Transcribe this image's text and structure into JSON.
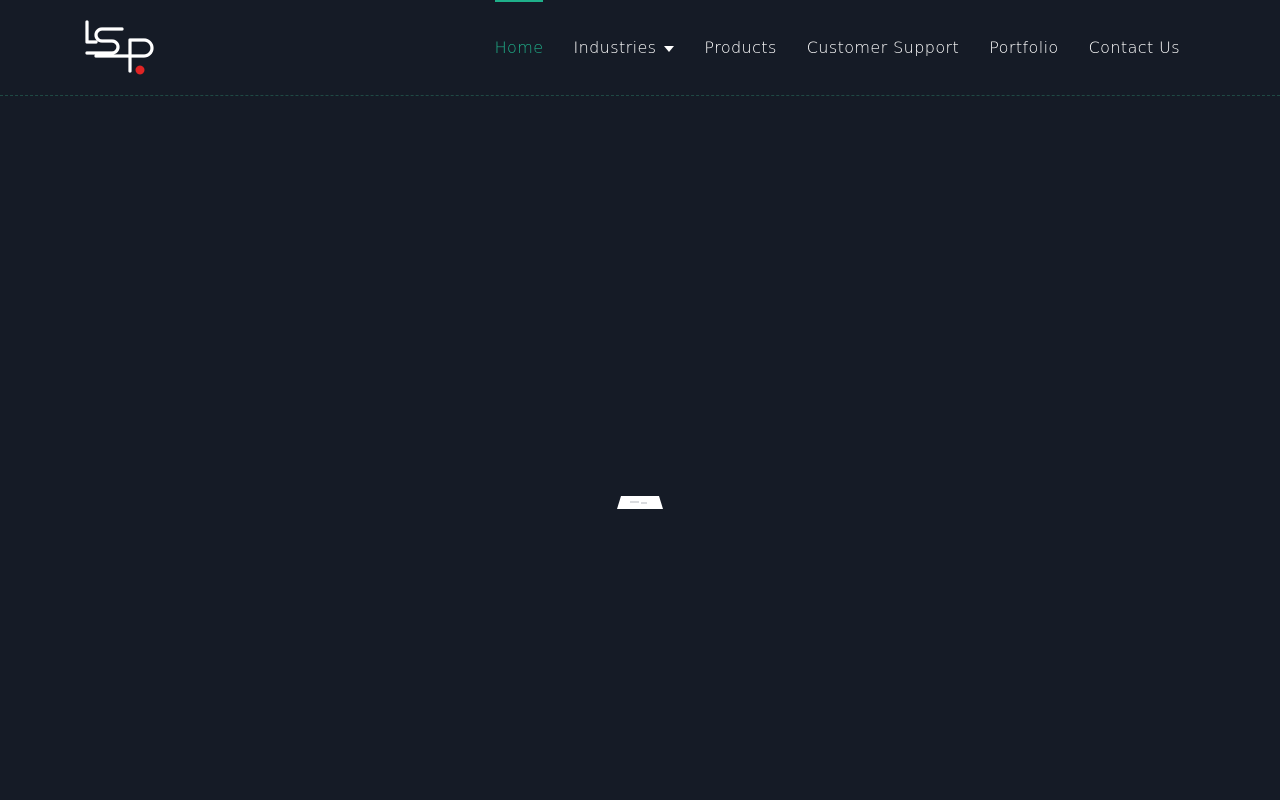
{
  "brand": {
    "logo_icon": "lsp-logo-icon",
    "accent_color": "#1fb08a",
    "logo_dot_color": "#e02424"
  },
  "nav": {
    "items": [
      {
        "label": "Home",
        "active": true
      },
      {
        "label": "Industries",
        "has_dropdown": true
      },
      {
        "label": "Products"
      },
      {
        "label": "Customer Support"
      },
      {
        "label": "Portfolio"
      },
      {
        "label": "Contact Us"
      }
    ]
  },
  "colors": {
    "background": "#151b26",
    "nav_text": "#ffffff",
    "divider": "#1f4a44"
  },
  "main": {
    "loader_icon": "loading-laptop-icon"
  }
}
